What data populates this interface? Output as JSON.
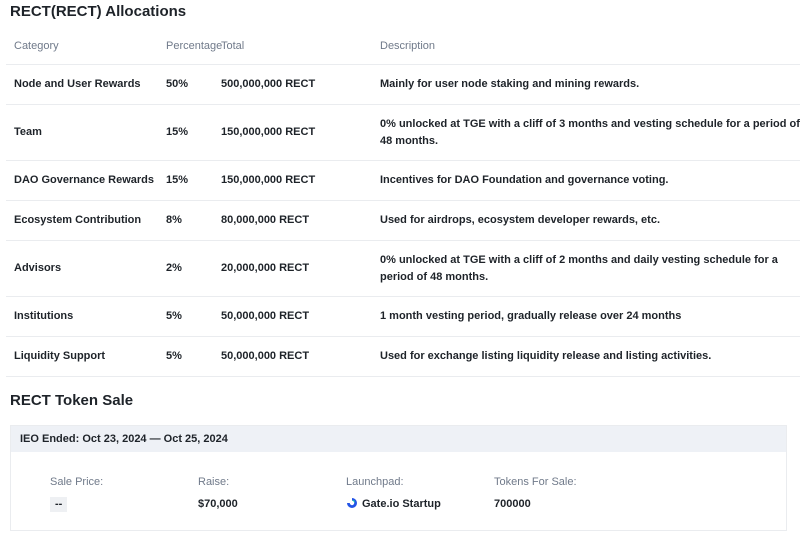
{
  "allocations": {
    "title": "RECT(RECT) Allocations",
    "headers": {
      "category": "Category",
      "percentage": "Percentage",
      "total": "Total",
      "description": "Description"
    },
    "rows": [
      {
        "category": "Node and User Rewards",
        "percentage": "50%",
        "total": "500,000,000 RECT",
        "description": "Mainly for user node staking and mining rewards."
      },
      {
        "category": "Team",
        "percentage": "15%",
        "total": "150,000,000 RECT",
        "description": "0% unlocked at TGE with a cliff of 3 months and vesting schedule for a period of 48 months."
      },
      {
        "category": "DAO Governance Rewards",
        "percentage": "15%",
        "total": "150,000,000 RECT",
        "description": "Incentives for DAO Foundation and governance voting."
      },
      {
        "category": "Ecosystem Contribution",
        "percentage": "8%",
        "total": "80,000,000 RECT",
        "description": "Used for airdrops, ecosystem developer rewards, etc."
      },
      {
        "category": "Advisors",
        "percentage": "2%",
        "total": "20,000,000 RECT",
        "description": "0% unlocked at TGE with a cliff of 2 months and daily vesting schedule for a period of 48 months."
      },
      {
        "category": "Institutions",
        "percentage": "5%",
        "total": "50,000,000 RECT",
        "description": "1 month vesting period, gradually release over 24 months"
      },
      {
        "category": "Liquidity Support",
        "percentage": "5%",
        "total": "50,000,000 RECT",
        "description": "Used for exchange listing liquidity release and listing activities."
      }
    ]
  },
  "token_sale": {
    "title": "RECT Token Sale",
    "header": "IEO Ended: Oct 23, 2024 — Oct 25, 2024",
    "fields": {
      "sale_price_label": "Sale Price:",
      "sale_price_value": "--",
      "raise_label": "Raise:",
      "raise_value": "$70,000",
      "launchpad_label": "Launchpad:",
      "launchpad_value": "Gate.io Startup",
      "launchpad_icon": "gate-io-logo-icon",
      "tokens_label": "Tokens For Sale:",
      "tokens_value": "700000"
    }
  },
  "colors": {
    "text_primary": "#1e2329",
    "text_secondary": "#707a8a",
    "header_bg": "#eef1f6",
    "gate_blue": "#2354e6",
    "gate_green": "#17e6a1"
  }
}
